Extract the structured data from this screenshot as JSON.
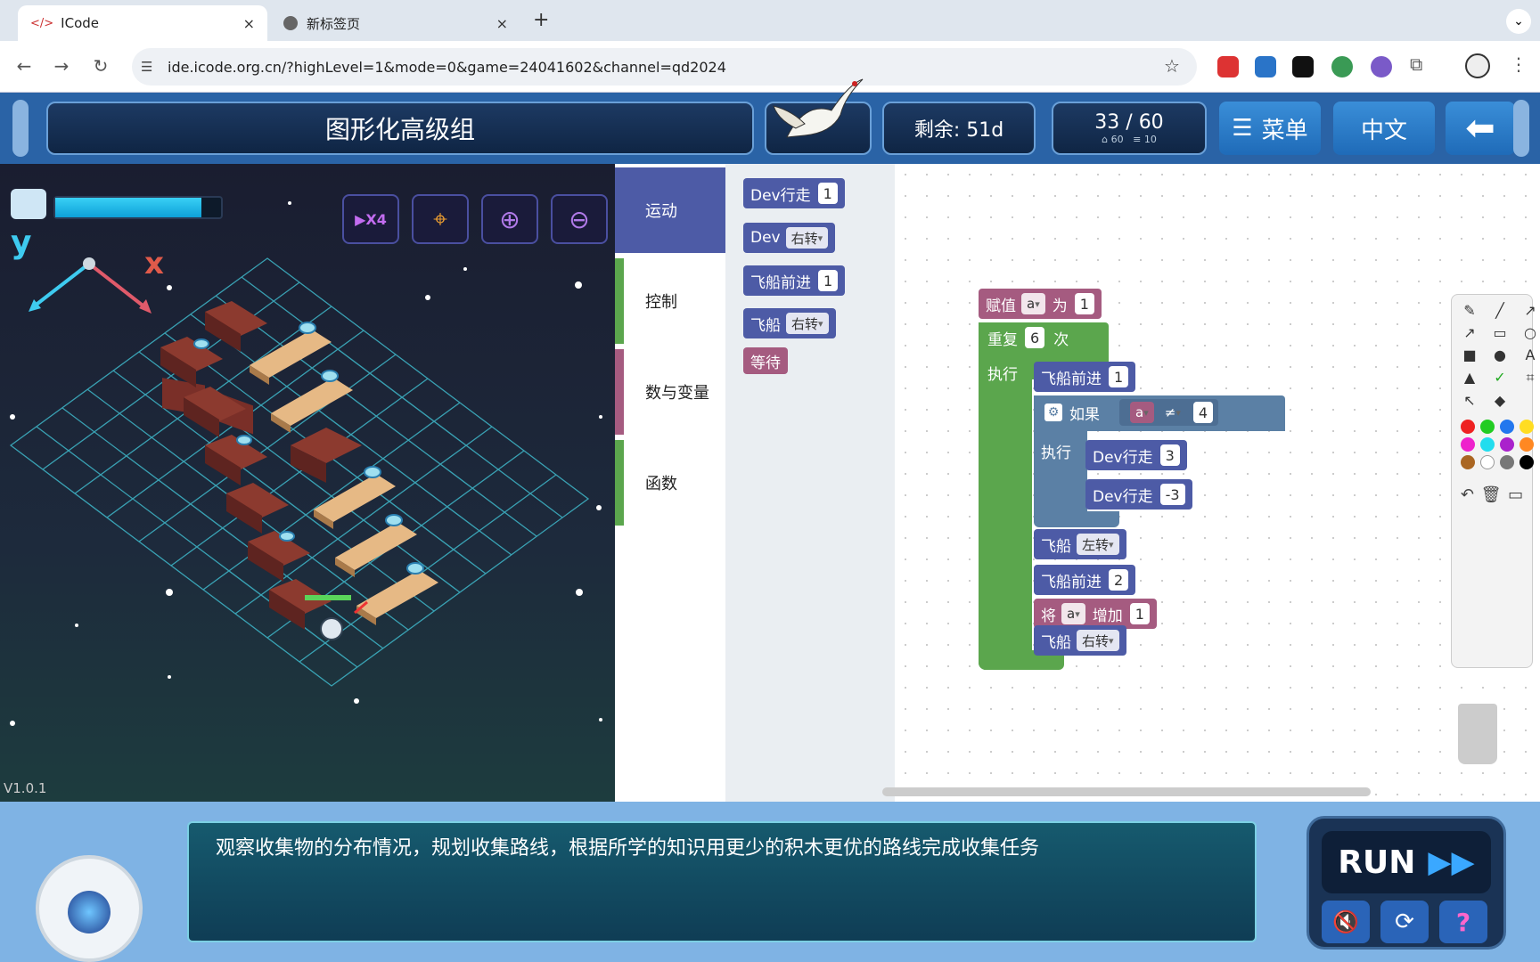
{
  "browser": {
    "tabs": [
      {
        "title": "ICode",
        "close": "×"
      },
      {
        "title": "新标签页",
        "close": "×"
      }
    ],
    "new_tab": "+",
    "url": "ide.icode.org.cn/?highLevel=1&mode=0&game=24041602&channel=qd2024",
    "icons": [
      "back-icon",
      "forward-icon",
      "reload-icon",
      "site-settings-icon",
      "bookmark-star-icon",
      "extension-icon",
      "profile-icon",
      "menu-icon"
    ]
  },
  "header": {
    "title": "图形化高级组",
    "remaining": "剩余: 51d",
    "progress": "33 / 60",
    "progress_sub_a": "60",
    "progress_sub_b": "10",
    "menu_label": "菜单",
    "lang_label": "中文"
  },
  "game": {
    "axis_y": "y",
    "axis_x": "x",
    "version": "V1.0.1",
    "speed_badge": "X4",
    "energy_level": 0.88
  },
  "categories": [
    {
      "label": "运动",
      "color": "#4d5ba6"
    },
    {
      "label": "控制",
      "color": "#5ba64d"
    },
    {
      "label": "数与变量",
      "color": "#a55b80"
    },
    {
      "label": "函数",
      "color": "#5ba64d"
    }
  ],
  "flyout": {
    "b1": {
      "label": "Dev行走",
      "value": "1"
    },
    "b2": {
      "label": "Dev",
      "dropdown": "右转"
    },
    "b3": {
      "label": "飞船前进",
      "value": "1"
    },
    "b4": {
      "label": "飞船",
      "dropdown": "右转"
    },
    "b5": {
      "label": "等待"
    }
  },
  "program": {
    "assign": {
      "label": "赋值",
      "var": "a",
      "to": "为",
      "value": "1"
    },
    "repeat": {
      "label": "重复",
      "times": "6",
      "suffix": "次",
      "exec": "执行"
    },
    "s1": {
      "label": "飞船前进",
      "value": "1"
    },
    "if": {
      "label": "如果",
      "var": "a",
      "op": "≠",
      "value": "4",
      "exec": "执行"
    },
    "if1": {
      "label": "Dev行走",
      "value": "3"
    },
    "if2": {
      "label": "Dev行走",
      "value": "-3"
    },
    "s2": {
      "label": "飞船",
      "dropdown": "左转"
    },
    "s3": {
      "label": "飞船前进",
      "value": "2"
    },
    "s4": {
      "label": "将",
      "var": "a",
      "inc": "增加",
      "value": "1"
    },
    "s5": {
      "label": "飞船",
      "dropdown": "右转"
    }
  },
  "hint": "观察收集物的分布情况，规划收集路线，根据所学的知识用更少的积木更优的路线完成收集任务",
  "run_label": "RUN"
}
